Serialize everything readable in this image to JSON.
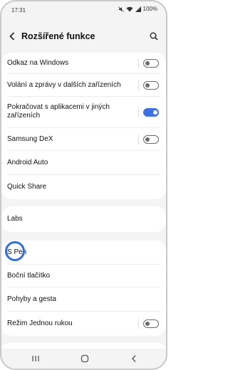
{
  "status": {
    "time": "17:31",
    "battery": "100%"
  },
  "header": {
    "title": "Rozšířené funkce"
  },
  "groups": [
    {
      "items": [
        {
          "label": "Odkaz na Windows",
          "toggle": false
        },
        {
          "label": "Volání a zprávy v dalších zařízeních",
          "toggle": false
        },
        {
          "label": "Pokračovat s aplikacemi v jiných zařízeních",
          "toggle": true
        },
        {
          "label": "Samsung DeX",
          "toggle": false
        },
        {
          "label": "Android Auto"
        },
        {
          "label": "Quick Share"
        }
      ]
    },
    {
      "items": [
        {
          "label": "Labs"
        }
      ]
    },
    {
      "items": [
        {
          "label": "S Pen"
        },
        {
          "label": "Boční tlačítko"
        },
        {
          "label": "Pohyby a gesta"
        },
        {
          "label": "Režim Jednou rukou",
          "toggle": false
        }
      ]
    }
  ],
  "colors": {
    "accent": "#3e71e6",
    "highlight": "#2f6fdc",
    "background": "#f4f4f4"
  },
  "icons": {
    "back": "chevron-left-icon",
    "search": "search-icon",
    "nav_recent": "recent-apps-icon",
    "nav_home": "home-icon",
    "nav_back": "back-icon"
  }
}
